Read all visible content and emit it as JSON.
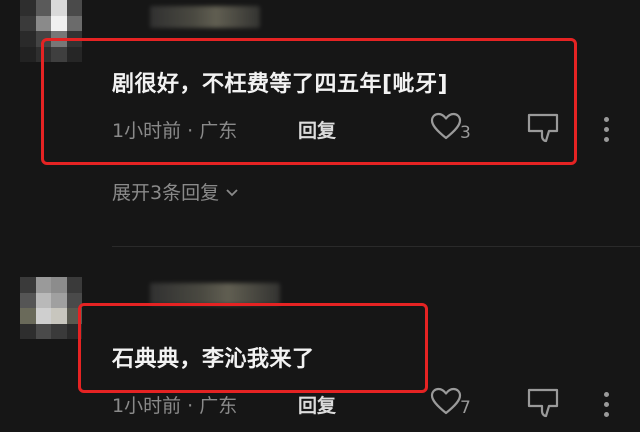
{
  "comments": [
    {
      "text": "剧很好，不枉费等了四五年[呲牙]",
      "time_location": "1小时前 · 广东",
      "reply_label": "回复",
      "like_count": "3",
      "replies_toggle": "展开3条回复"
    },
    {
      "text": "石典典，李沁我来了",
      "time_location": "1小时前 · 广东",
      "reply_label": "回复",
      "like_count": "7"
    }
  ],
  "colors": {
    "background": "#161616",
    "highlight": "#e52323",
    "muted_text": "#8a8a8a"
  },
  "icons": [
    "heart-outline-icon",
    "dislike-icon",
    "more-vertical-icon",
    "chevron-down-icon"
  ]
}
